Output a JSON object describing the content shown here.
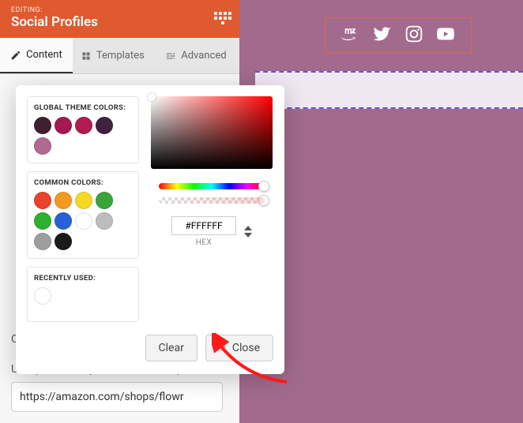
{
  "header": {
    "editing_label": "EDITING:",
    "title": "Social Profiles"
  },
  "tabs": {
    "content": "Content",
    "templates": "Templates",
    "advanced": "Advanced"
  },
  "fields": {
    "color_label": "Color",
    "url_label": "URL (Include https:// for web links)",
    "url_value": "https://amazon.com/shops/flowr"
  },
  "color_picker": {
    "global_title": "GLOBAL THEME COLORS:",
    "common_title": "COMMON COLORS:",
    "recent_title": "RECENTLY USED:",
    "hex_value": "#FFFFFF",
    "hex_label": "HEX",
    "clear": "Clear",
    "close": "Close",
    "global_colors": [
      "#3f1f30",
      "#a41950",
      "#b01c4f",
      "#3f2240",
      "#b1698f"
    ],
    "common_colors": [
      "#e9432b",
      "#f19a1f",
      "#f3d924",
      "#3aa33a",
      "#2fae2f",
      "#2860d8",
      "#ffffff",
      "#bdbdbd",
      "#9e9e9e",
      "#1a1a1a"
    ],
    "recent_colors": [
      "#ffffff"
    ]
  },
  "preview": {
    "icons": [
      "amazon-icon",
      "twitter-icon",
      "instagram-icon",
      "youtube-icon"
    ]
  }
}
